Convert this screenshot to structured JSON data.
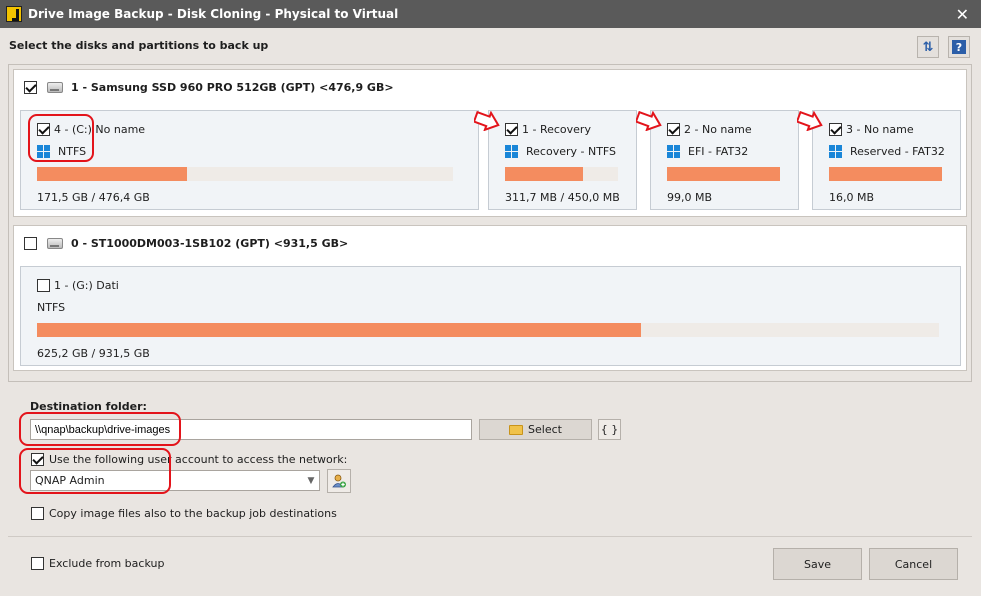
{
  "window": {
    "title": "Drive Image Backup - Disk Cloning - Physical to Virtual",
    "close_glyph": "✕"
  },
  "header": {
    "label": "Select the disks and partitions to back up",
    "swap_icon": "swap-arrows-icon",
    "help_glyph": "?"
  },
  "disks": [
    {
      "title": "1 - Samsung SSD 960 PRO 512GB (GPT) <476,9 GB>",
      "checked": true,
      "partitions": [
        {
          "label": "4 - (C:) No name",
          "fs": "NTFS",
          "size": "171,5 GB / 476,4 GB",
          "used_fraction": 0.36,
          "checked": true,
          "windows_icon": true
        },
        {
          "label": "1 -  Recovery",
          "fs": "Recovery - NTFS",
          "size": "311,7 MB / 450,0 MB",
          "used_fraction": 0.69,
          "checked": true,
          "windows_icon": true
        },
        {
          "label": "2 -  No name",
          "fs": "EFI - FAT32",
          "size": "99,0 MB",
          "used_fraction": 1.0,
          "checked": true,
          "windows_icon": true
        },
        {
          "label": "3 -  No name",
          "fs": "Reserved - FAT32",
          "size": "16,0 MB",
          "used_fraction": 1.0,
          "checked": true,
          "windows_icon": true
        }
      ]
    },
    {
      "title": "0 - ST1000DM003-1SB102 (GPT) <931,5 GB>",
      "checked": false,
      "partitions": [
        {
          "label": "1 - (G:) Dati",
          "fs": "NTFS",
          "size": "625,2 GB / 931,5 GB",
          "used_fraction": 0.67,
          "checked": false,
          "windows_icon": false
        }
      ]
    }
  ],
  "destination": {
    "label": "Destination folder:",
    "path": "\\\\qnap\\backup\\drive-images",
    "select_label": "Select",
    "braces_label": "{ }"
  },
  "network": {
    "use_account_label": "Use the following user account to access the network:",
    "use_account_checked": true,
    "account": "QNAP Admin"
  },
  "options": {
    "copy_label": "Copy image files also to the backup job destinations",
    "copy_checked": false,
    "exclude_label": "Exclude from backup",
    "exclude_checked": false
  },
  "buttons": {
    "save": "Save",
    "cancel": "Cancel"
  },
  "colors": {
    "titlebar": "#5a5a5a",
    "usage_bar": "#f48c5f",
    "annotation": "#e3141b",
    "windows_blue": "#1a86d8"
  }
}
